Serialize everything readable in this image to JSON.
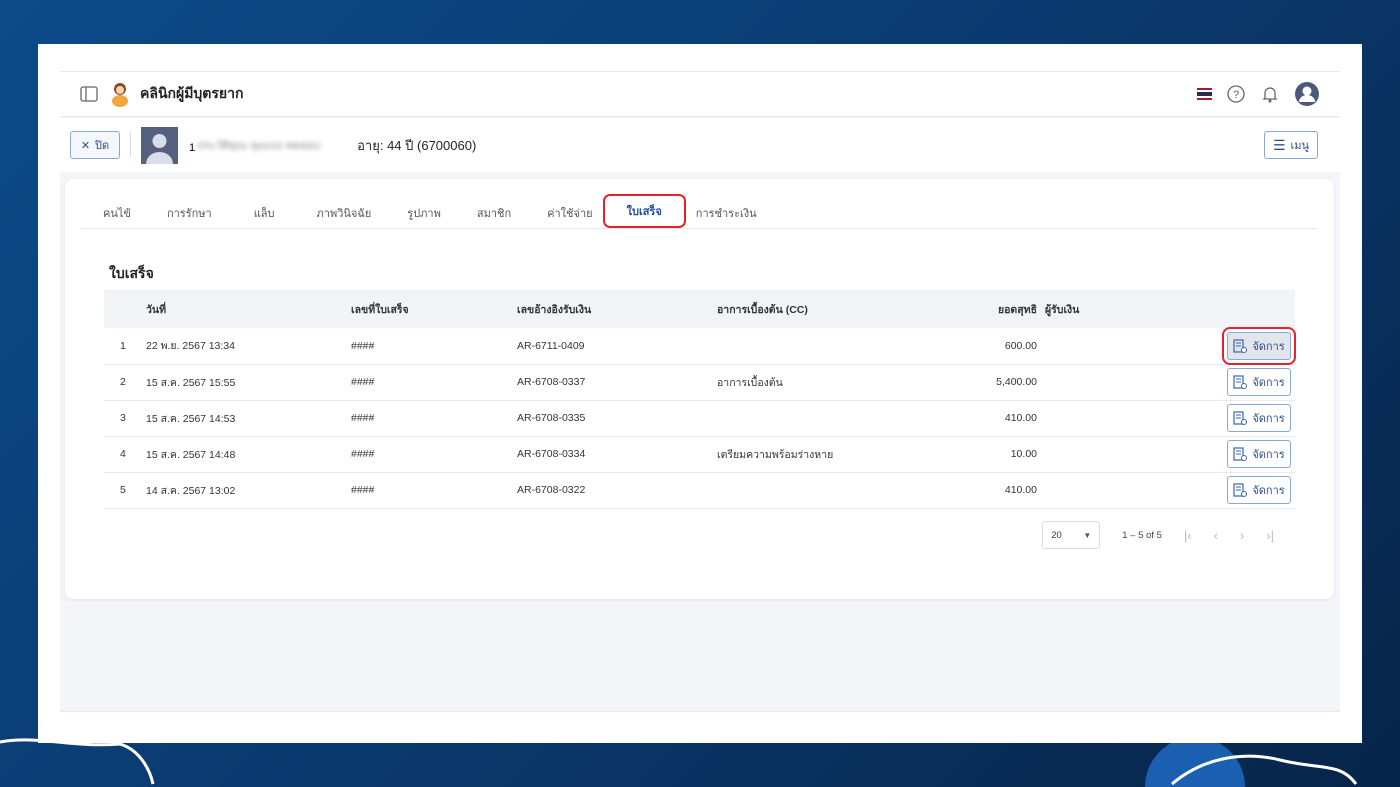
{
  "header": {
    "clinic_name": "คลินิกผู้มีบุตรยาก"
  },
  "patient": {
    "close_label": "ปิด",
    "index": "1",
    "name": "ประวัติคุณ จุมแจง ทดสอบ",
    "age_info": "อายุ: 44 ปี (6700060)",
    "menu_label": "เมนู"
  },
  "tabs": [
    "คนไข้",
    "การรักษา",
    "แล็บ",
    "ภาพวินิจฉัย",
    "รูปภาพ",
    "สมาชิก",
    "ค่าใช้จ่าย",
    "ใบเสร็จ",
    "การชำระเงิน"
  ],
  "active_tab": "ใบเสร็จ",
  "section_title": "ใบเสร็จ",
  "table": {
    "headers": [
      "",
      "วันที่",
      "เลขที่ใบเสร็จ",
      "เลขอ้างอิงรับเงิน",
      "อาการเบื้องต้น (CC)",
      "ยอดสุทธิ",
      "ผู้รับเงิน",
      ""
    ],
    "rows": [
      [
        "1",
        "22 พ.ย. 2567 13:34",
        "####",
        "AR-6711-0409",
        "",
        "600.00",
        ""
      ],
      [
        "2",
        "15 ส.ค. 2567 15:55",
        "####",
        "AR-6708-0337",
        "อาการเบื้องต้น",
        "5,400.00",
        ""
      ],
      [
        "3",
        "15 ส.ค. 2567 14:53",
        "####",
        "AR-6708-0335",
        "",
        "410.00",
        ""
      ],
      [
        "4",
        "15 ส.ค. 2567 14:48",
        "####",
        "AR-6708-0334",
        "เตรียมความพร้อมร่างหาย",
        "10.00",
        ""
      ],
      [
        "5",
        "14 ส.ค. 2567 13:02",
        "####",
        "AR-6708-0322",
        "",
        "410.00",
        ""
      ]
    ],
    "action_label": "จัดการ"
  },
  "pagination": {
    "page_size": "20",
    "range": "1 – 5 of 5"
  }
}
